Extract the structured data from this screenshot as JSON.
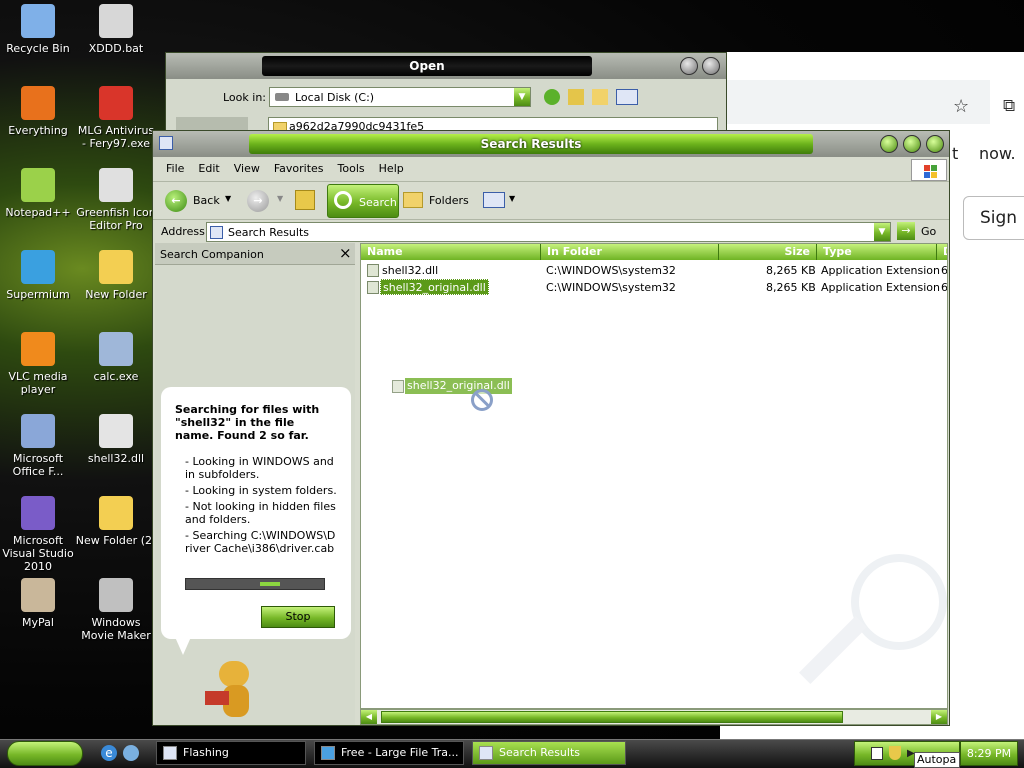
{
  "desktop_icons": [
    {
      "label": "Recycle Bin",
      "icon": "recycle-bin-icon",
      "color": "#7fb0e8"
    },
    {
      "label": "XDDD.bat",
      "icon": "gear-file-icon",
      "color": "#d7d7d7"
    },
    {
      "label": "Everything",
      "icon": "search-ring-icon",
      "color": "#e8711c"
    },
    {
      "label": "MLG Antivirus - Fery97.exe",
      "icon": "shield-icon",
      "color": "#d9352a"
    },
    {
      "label": "Notepad++",
      "icon": "notepad-icon",
      "color": "#9bd14a"
    },
    {
      "label": "Greenfish Icon Editor Pro",
      "icon": "icon-editor-icon",
      "color": "#e0e0e0"
    },
    {
      "label": "Supermium",
      "icon": "browser-icon",
      "color": "#3aa0e0"
    },
    {
      "label": "New Folder",
      "icon": "folder-icon",
      "color": "#f3cf52"
    },
    {
      "label": "VLC media player",
      "icon": "vlc-cone-icon",
      "color": "#f08a1c"
    },
    {
      "label": "calc.exe",
      "icon": "calculator-icon",
      "color": "#9fb7d9"
    },
    {
      "label": "Microsoft Office F...",
      "icon": "office-icon",
      "color": "#8aa7d8"
    },
    {
      "label": "shell32.dll",
      "icon": "dll-file-icon",
      "color": "#e4e4e4"
    },
    {
      "label": "Microsoft Visual Studio 2010",
      "icon": "infinity-icon",
      "color": "#7a5cc8"
    },
    {
      "label": "New Folder (2)",
      "icon": "folder-icon",
      "color": "#f3cf52"
    },
    {
      "label": "MyPal",
      "icon": "raccoon-icon",
      "color": "#c9b79a"
    },
    {
      "label": "Windows Movie Maker",
      "icon": "film-icon",
      "color": "#c0c0c0"
    }
  ],
  "chrome_bg": {
    "right_text": "now.",
    "partial_t": "t",
    "sign_label": "Sign"
  },
  "open_dialog": {
    "title": "Open",
    "look_in_label": "Look in:",
    "look_in_value": "Local Disk (C:)",
    "item": "a962d2a7990dc9431fe5"
  },
  "search_window": {
    "title": "Search Results",
    "menu": [
      "File",
      "Edit",
      "View",
      "Favorites",
      "Tools",
      "Help"
    ],
    "toolbar": {
      "back": "Back",
      "search": "Search",
      "folders": "Folders"
    },
    "address_label": "Address",
    "address_value": "Search Results",
    "go_label": "Go",
    "companion_title": "Search Companion",
    "close_glyph": "×",
    "bubble": {
      "heading": "Searching for files with \"shell32\" in the file name. Found 2 so far.",
      "bullets": [
        "- Looking in WINDOWS and in subfolders.",
        "- Looking in system folders.",
        "- Not looking in hidden files and folders.",
        "- Searching C:\\WINDOWS\\Driver Cache\\i386\\driver.cab"
      ],
      "stop_label": "Stop"
    },
    "columns": [
      "Name",
      "In Folder",
      "Size",
      "Type",
      "D"
    ],
    "rows": [
      {
        "name": "shell32.dll",
        "folder": "C:\\WINDOWS\\system32",
        "size": "8,265 KB",
        "type": "Application Extension",
        "d": "6"
      },
      {
        "name": "shell32_original.dll",
        "folder": "C:\\WINDOWS\\system32",
        "size": "8,265 KB",
        "type": "Application Extension",
        "d": "6"
      }
    ],
    "drag_label": "shell32_original.dll"
  },
  "taskbar": {
    "items": [
      {
        "label": "Flashing",
        "active": false
      },
      {
        "label": "Free - Large File Tra...",
        "active": false
      },
      {
        "label": "Search Results",
        "active": true
      }
    ],
    "clock": "8:29 PM",
    "tooltip": "Autopa"
  }
}
